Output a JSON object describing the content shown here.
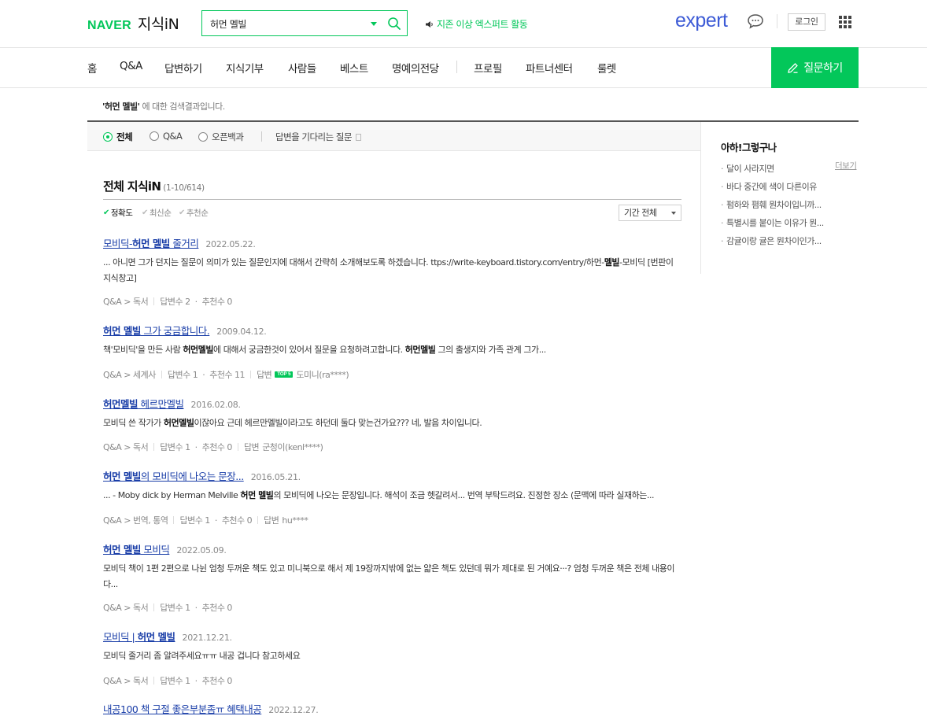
{
  "header": {
    "logo_naver": "NAVER",
    "logo_kin": "지식iN",
    "search_value": "허먼 멜빌",
    "notice": "지존 이상 엑스퍼트 활동",
    "expert": "expert",
    "login": "로그인",
    "colors": {
      "accent": "#03c75a",
      "expert": "#3d5bd6",
      "link": "#1a3ea8"
    }
  },
  "nav": {
    "items": [
      "홈",
      "Q&A",
      "답변하기",
      "지식기부",
      "사람들",
      "베스트",
      "명예의전당",
      "프로필",
      "파트너센터",
      "룰렛"
    ],
    "ask": "질문하기"
  },
  "result_note": {
    "query": "'허먼 멜빌'",
    "suffix": " 에 대한 검색결과입니다."
  },
  "filter": {
    "options": [
      "전체",
      "Q&A",
      "오픈백과"
    ],
    "selected": "전체",
    "waiting": "답변을 기다리는 질문"
  },
  "side": {
    "title": "아하!그렇구나",
    "more": "더보기",
    "items": [
      "달이 사라지면",
      "바다 중간에 색이 다른이유",
      "펌하와 폄훼 뭔차이입니까...",
      "특별시를 붙이는 이유가 뭔...",
      "감귤이랑 귤은 뭔차이인가..."
    ]
  },
  "main": {
    "title": "전체 지식iN",
    "count": "(1-10/614)",
    "sort": [
      "정확도",
      "최신순",
      "추천순"
    ],
    "period": "기간 전체"
  },
  "results": [
    {
      "title_pre": "모비딕-",
      "title_hl": "허먼 멜빌",
      "title_post": " 줄거리",
      "date": "2022.05.22.",
      "body_a": "... 아니면 그가 던지는 질문이 의미가 있는 질문인지에 대해서 간략히 소개해보도록 하겠습니다. ttps://write-keyboard.tistory.com/entry/하먼-",
      "body_hl1": "멜빌",
      "body_b": "-모비딕 [번판이 지식창고]",
      "body_hl2": "",
      "body_c": "",
      "category": "Q&A > 독서",
      "answers": "답변수 2",
      "recommend": "추천수 0",
      "answerer": ""
    },
    {
      "title_pre": "",
      "title_hl": "허먼 멜빌",
      "title_post": " 그가 궁금합니다.",
      "date": "2009.04.12.",
      "body_a": "책'모비딕'을 만든 사람 ",
      "body_hl1": "허먼멜빌",
      "body_b": "에 대해서 궁금한것이 있어서 질문을 요청하려고합니다. ",
      "body_hl2": "허먼멜빌",
      "body_c": " 그의 출생지와 가족 관계 그가...",
      "category": "Q&A > 세계사",
      "answers": "답변수 1",
      "recommend": "추천수 11",
      "answerer": "도미니(ra****)",
      "badge": "TOP 5"
    },
    {
      "title_pre": "",
      "title_hl": "허먼멜빌",
      "title_post": " 헤르만멜빌",
      "date": "2016.02.08.",
      "body_a": "모비딕 쓴 작가가 ",
      "body_hl1": "허먼멜빌",
      "body_b": "이잖아요 근데 헤르만멜빌이라고도 하던데 둘다 맞는건가요??? 네, 발음 차이입니다.",
      "body_hl2": "",
      "body_c": "",
      "category": "Q&A > 독서",
      "answers": "답변수 1",
      "recommend": "추천수 0",
      "answerer": "군청이(kenl****)"
    },
    {
      "title_pre": "",
      "title_hl": "허먼 멜빌",
      "title_post": "의 모비딕에 나오는 문장...",
      "date": "2016.05.21.",
      "body_a": "... - Moby dick by Herman Melville ",
      "body_hl1": "허먼 멜빌",
      "body_b": "의 모비딕에 나오는 문장입니다. 해석이 조금 헷갈려서... 번역 부탁드려요. 진정한 장소 (문맥에 따라 실재하는...",
      "body_hl2": "",
      "body_c": "",
      "category": "Q&A > 번역, 통역",
      "answers": "답변수 1",
      "recommend": "추천수 0",
      "answerer": "hu****"
    },
    {
      "title_pre": "",
      "title_hl": "허먼 멜빌",
      "title_post": " 모비딕",
      "date": "2022.05.09.",
      "body_a": "모비딕 책이 1편 2편으로 나뉜 엄청 두꺼운 책도 있고 미니북으로 해서 제 19장까지밖에 없는 얇은 책도 있던데 뭐가 제대로 된 거예요···? 엄청 두꺼운 책은 전체 내용이 다...",
      "body_hl1": "",
      "body_b": "",
      "body_hl2": "",
      "body_c": "",
      "category": "Q&A > 독서",
      "answers": "답변수 1",
      "recommend": "추천수 0",
      "answerer": ""
    },
    {
      "title_pre": "모비딕 | ",
      "title_hl": "허먼 멜빌",
      "title_post": "",
      "date": "2021.12.21.",
      "body_a": "모비딕 줄거리 좀 알려주세요ㅠㅠ 내공 겁니다 참고하세요",
      "body_hl1": "",
      "body_b": "",
      "body_hl2": "",
      "body_c": "",
      "category": "Q&A > 독서",
      "answers": "답변수 1",
      "recommend": "추천수 0",
      "answerer": ""
    },
    {
      "title_pre": "내공100 책 구절 좋은부분좀ㅠ 혜택내공",
      "title_hl": "",
      "title_post": "",
      "date": "2022.12.27.",
      "body_a": "",
      "body_hl1": "",
      "body_b": "",
      "body_hl2": "",
      "body_c": "",
      "category": "",
      "answers": "",
      "recommend": "",
      "answerer": ""
    }
  ]
}
